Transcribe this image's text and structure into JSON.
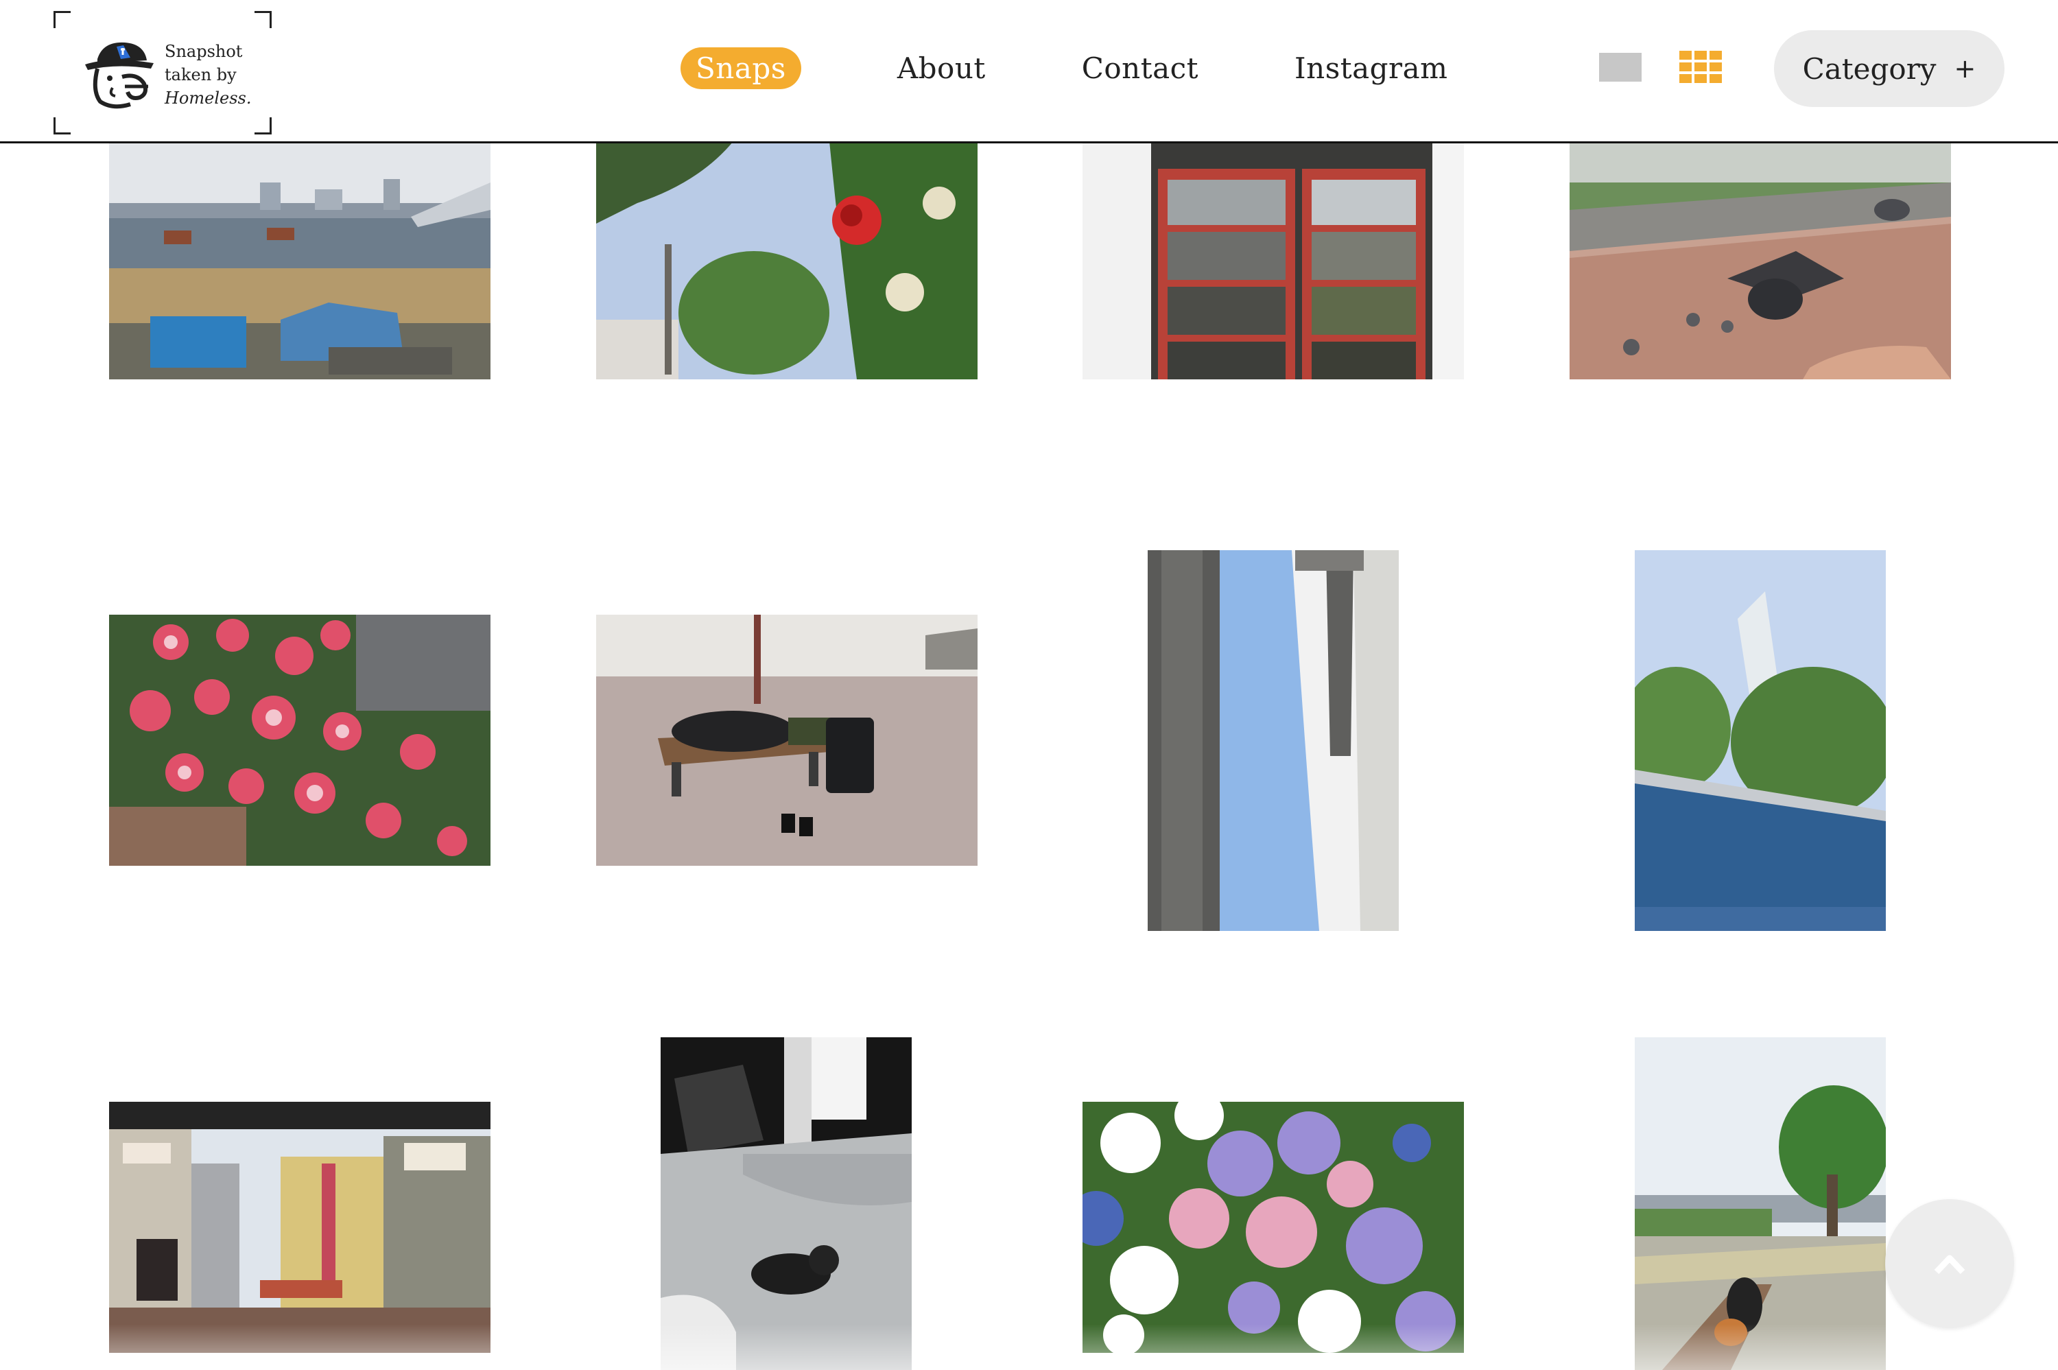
{
  "logo": {
    "line1": "Snapshot",
    "line2": "taken by",
    "line3": "Homeless.",
    "icon": "homeless-cap-face-icon"
  },
  "nav": {
    "items": [
      {
        "label": "Snaps",
        "active": true
      },
      {
        "label": "About",
        "active": false
      },
      {
        "label": "Contact",
        "active": false
      },
      {
        "label": "Instagram",
        "active": false
      }
    ]
  },
  "view_toggle": {
    "single_icon": "single-view-icon",
    "grid_icon": "grid-view-icon",
    "selected": "grid"
  },
  "category": {
    "label": "Category",
    "icon": "+"
  },
  "colors": {
    "accent": "#f4ac2f",
    "category_bg": "#ebebeb",
    "single_view_icon": "#c7c7c7"
  },
  "gallery": {
    "photos": [
      {
        "subject": "riverbank-tents-photo",
        "orientation": "landscape"
      },
      {
        "subject": "red-rose-sky-photo",
        "orientation": "landscape"
      },
      {
        "subject": "red-window-frame-photo",
        "orientation": "landscape"
      },
      {
        "subject": "pigeons-feeding-photo",
        "orientation": "landscape"
      },
      {
        "subject": "pink-roses-photo",
        "orientation": "landscape"
      },
      {
        "subject": "man-sleeping-on-bench-photo",
        "orientation": "landscape"
      },
      {
        "subject": "sky-between-buildings-photo",
        "orientation": "portrait"
      },
      {
        "subject": "tower-and-fountain-photo",
        "orientation": "portrait"
      },
      {
        "subject": "shopping-street-photo",
        "orientation": "landscape"
      },
      {
        "subject": "cat-at-night-photo",
        "orientation": "portrait"
      },
      {
        "subject": "hydrangeas-photo",
        "orientation": "landscape"
      },
      {
        "subject": "person-on-park-bench-photo",
        "orientation": "portrait"
      }
    ]
  },
  "scroll_top": {
    "icon": "chevron-up-icon"
  }
}
